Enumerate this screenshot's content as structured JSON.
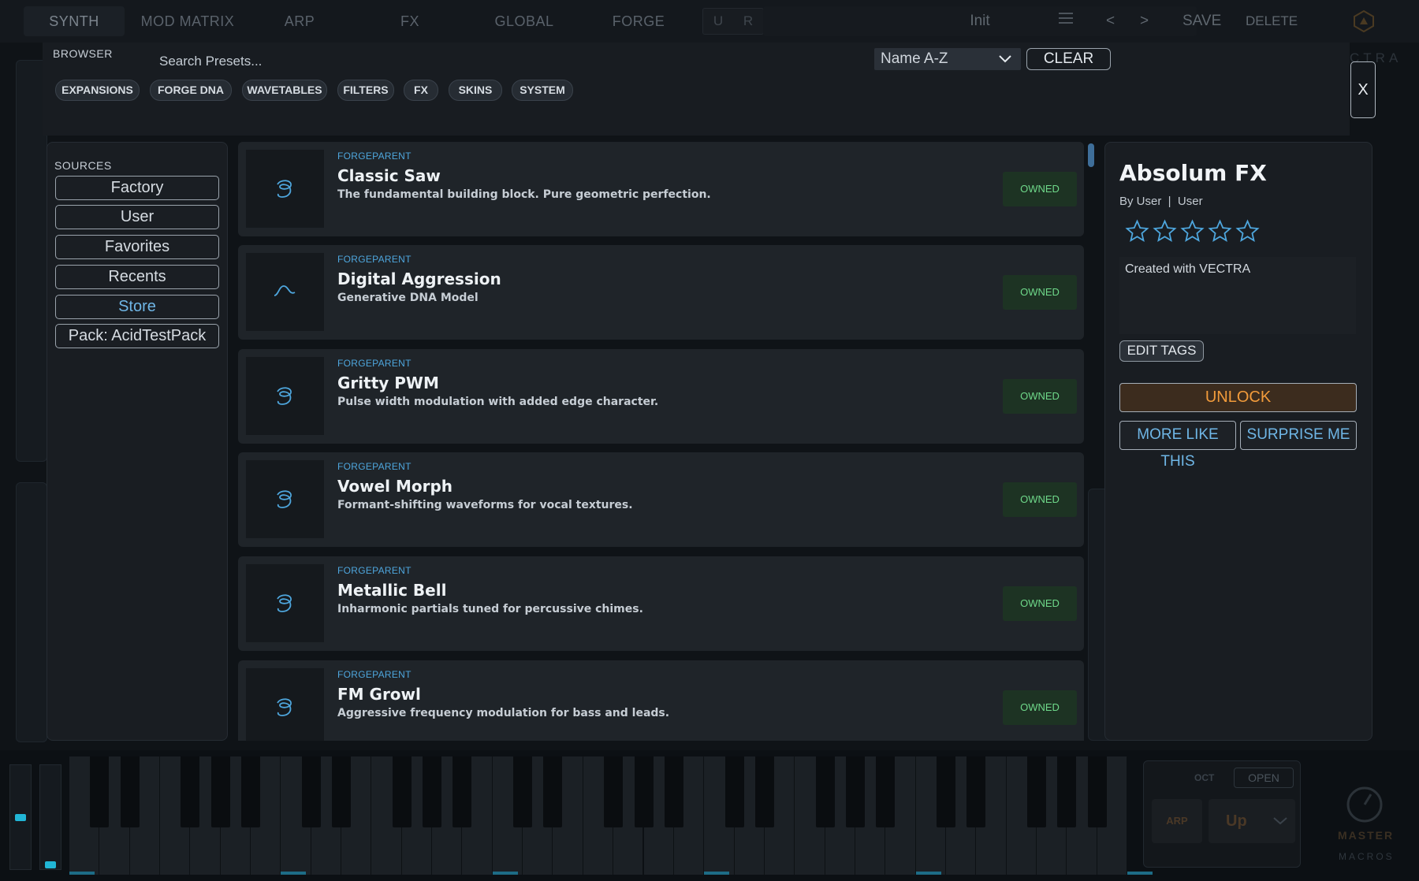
{
  "topbar": {
    "tabs": [
      "SYNTH",
      "MOD MATRIX",
      "ARP",
      "FX",
      "GLOBAL",
      "FORGE"
    ],
    "undo": "U",
    "redo": "R",
    "preset_name": "Init",
    "menu_icon": "hamburger-icon",
    "prev": "<",
    "next": ">",
    "save": "SAVE",
    "delete": "DELETE"
  },
  "browser": {
    "label": "BROWSER",
    "search_placeholder": "Search Presets...",
    "sort": "Name A-Z",
    "clear": "CLEAR",
    "close": "X",
    "filters": [
      "EXPANSIONS",
      "FORGE DNA",
      "WAVETABLES",
      "FILTERS",
      "FX",
      "SKINS",
      "SYSTEM"
    ]
  },
  "sources": {
    "label": "SOURCES",
    "items": [
      "Factory",
      "User",
      "Favorites",
      "Recents",
      "Store",
      "Pack: AcidTestPack"
    ],
    "active": "Store"
  },
  "presets": [
    {
      "category": "FORGEPARENT",
      "name": "Classic Saw",
      "description": "The fundamental building block. Pure geometric perfection.",
      "status": "OWNED",
      "icon": "spiral-icon"
    },
    {
      "category": "FORGEPARENT",
      "name": "Digital Aggression",
      "description": "Generative DNA Model",
      "status": "OWNED",
      "icon": "sine-wave-icon"
    },
    {
      "category": "FORGEPARENT",
      "name": "Gritty PWM",
      "description": "Pulse width modulation with added edge character.",
      "status": "OWNED",
      "icon": "spiral-icon"
    },
    {
      "category": "FORGEPARENT",
      "name": "Vowel Morph",
      "description": "Formant-shifting waveforms for vocal textures.",
      "status": "OWNED",
      "icon": "spiral-icon"
    },
    {
      "category": "FORGEPARENT",
      "name": "Metallic Bell",
      "description": "Inharmonic partials tuned for percussive chimes.",
      "status": "OWNED",
      "icon": "spiral-icon"
    },
    {
      "category": "FORGEPARENT",
      "name": "FM Growl",
      "description": "Aggressive frequency modulation for bass and leads.",
      "status": "OWNED",
      "icon": "spiral-icon"
    }
  ],
  "detail": {
    "title": "Absolum FX",
    "author_line": "By User  |  User",
    "rating": 0,
    "rating_max": 5,
    "description": "Created with VECTRA",
    "edit_tags": "EDIT TAGS",
    "unlock": "UNLOCK",
    "more_like_this": "MORE LIKE THIS",
    "surprise_me": "SURPRISE ME"
  },
  "bottom": {
    "oct": "OCT",
    "open": "OPEN",
    "arp": "ARP",
    "arp_mode": "Up",
    "master": "MASTER",
    "macros": "MACROS"
  },
  "colors": {
    "accent_blue": "#4ea6dd",
    "owned_green": "#6fd98a",
    "unlock_orange": "#f29b3b",
    "panel": "#191d22"
  }
}
